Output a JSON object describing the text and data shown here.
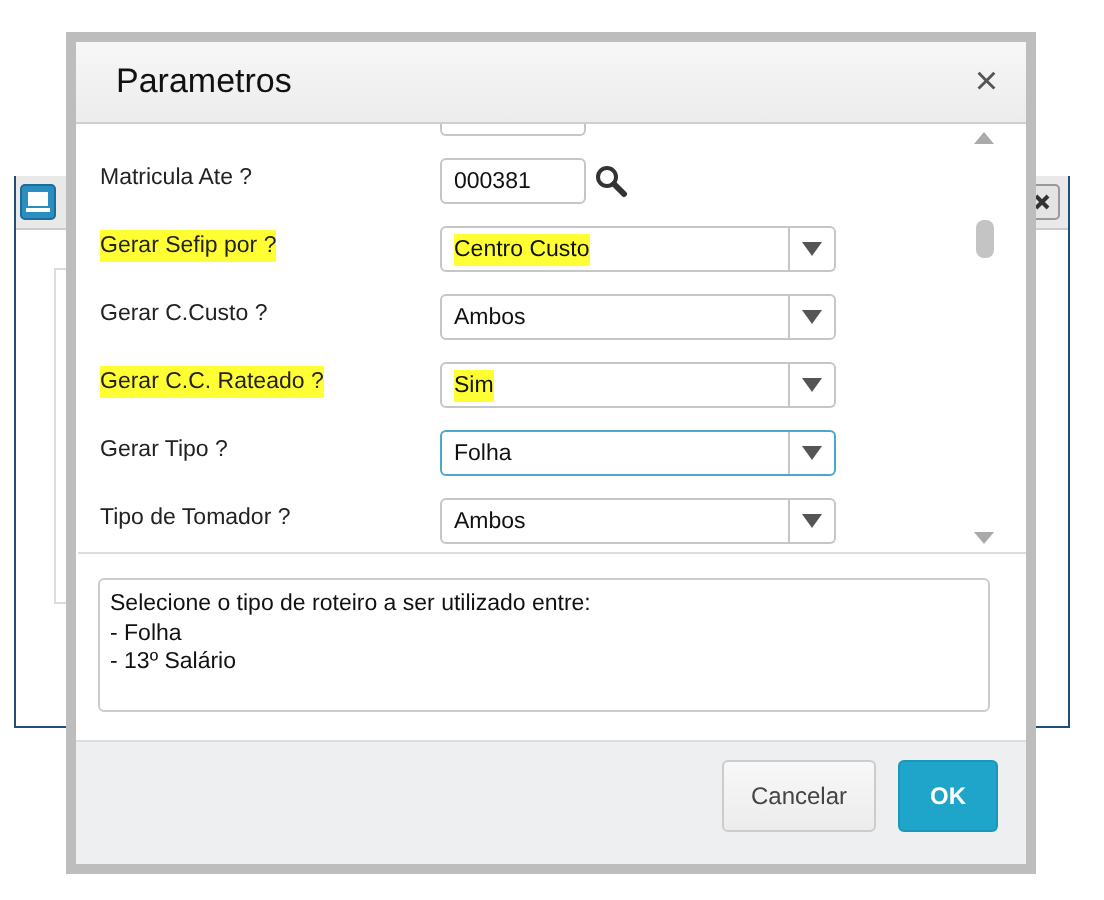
{
  "dialog": {
    "title": "Parametros",
    "close": "×"
  },
  "params": [
    {
      "kind": "lookup",
      "label": "Matricula Ate ?",
      "value": "000381",
      "highlighted": false,
      "focused": false
    },
    {
      "kind": "select",
      "label": "Gerar Sefip por ?",
      "value": "Centro Custo",
      "highlighted": true,
      "focused": false
    },
    {
      "kind": "select",
      "label": "Gerar C.Custo ?",
      "value": "Ambos",
      "highlighted": false,
      "focused": false
    },
    {
      "kind": "select",
      "label": "Gerar C.C. Rateado ?",
      "value": "Sim",
      "highlighted": true,
      "focused": false
    },
    {
      "kind": "select",
      "label": "Gerar Tipo ?",
      "value": "Folha",
      "highlighted": false,
      "focused": true
    },
    {
      "kind": "select",
      "label": "Tipo de Tomador ?",
      "value": "Ambos",
      "highlighted": false,
      "focused": false
    }
  ],
  "description": [
    "Selecione o tipo de roteiro a ser utilizado entre:",
    "- Folha",
    "- 13º Salário"
  ],
  "buttons": [
    {
      "label": "Cancelar",
      "kind": "secondary"
    },
    {
      "label": "OK",
      "kind": "primary"
    }
  ]
}
